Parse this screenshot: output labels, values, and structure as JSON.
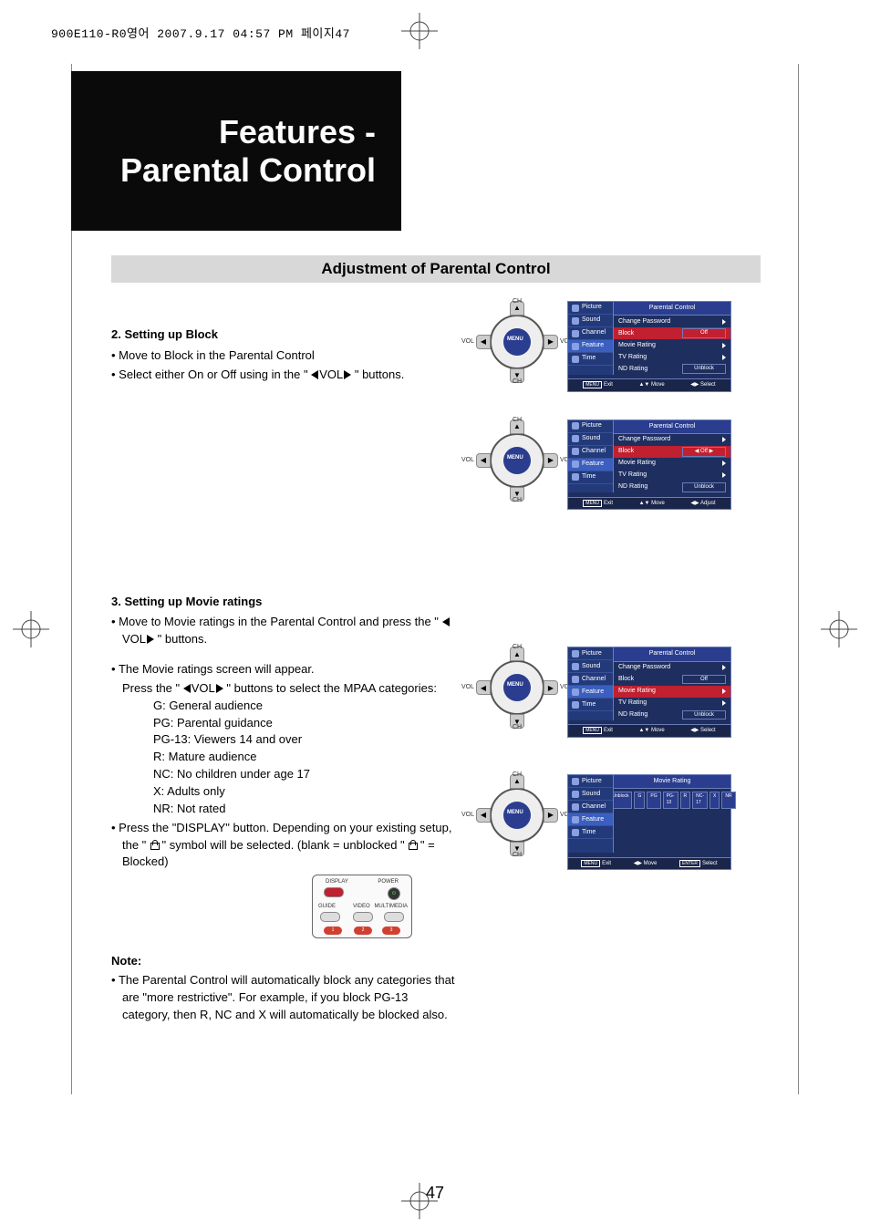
{
  "header_strip": "900E110-R0영어  2007.9.17 04:57 PM 페이지47",
  "title": {
    "line1": "Features -",
    "line2": "Parental Control"
  },
  "subheading": "Adjustment of Parental Control",
  "page_number": "47",
  "sections": {
    "block": {
      "heading": "2. Setting up Block",
      "b1": "Move to Block in the Parental Control",
      "b2_a": "Select either On or Off using in the \" ",
      "b2_b": "VOL",
      "b2_c": " \" buttons."
    },
    "movie": {
      "heading": "3. Setting up Movie ratings",
      "b1_a": "Move to Movie ratings in the Parental Control and press the \" ",
      "b1_b": "VOL",
      "b1_c": " \" buttons.",
      "b2": "The Movie ratings screen will appear.",
      "b2_line_a": "Press the \" ",
      "b2_line_b": "VOL",
      "b2_line_c": " \" buttons to select the MPAA categories:",
      "ratings": {
        "g": "G: General audience",
        "pg": "PG: Parental guidance",
        "pg13": "PG-13: Viewers 14 and over",
        "r": "R: Mature audience",
        "nc": "NC: No children under age 17",
        "x": "X: Adults only",
        "nr": "NR: Not rated"
      },
      "b3_a": "Press the \"DISPLAY\" button. Depending on your existing setup, the \" ",
      "b3_b": " \" symbol will be selected. (blank = unblocked \" ",
      "b3_c": " \" = Blocked)"
    },
    "note": {
      "heading": "Note:",
      "b1": "The Parental Control will automatically block any categories that are \"more restrictive\". For example, if you block PG-13 category, then R, NC and X will automatically be blocked also."
    }
  },
  "dpad": {
    "menu": "MENU",
    "ch": "CH",
    "vol": "VOL"
  },
  "osd": {
    "side": {
      "picture": "Picture",
      "sound": "Sound",
      "channel": "Channel",
      "feature": "Feature",
      "time": "Time"
    },
    "title_pc": "Parental Control",
    "title_mr": "Movie Rating",
    "rows": {
      "change_pw": "Change Password",
      "block": "Block",
      "movie_rating": "Movie Rating",
      "tv_rating": "TV Rating",
      "nd_rating": "ND Rating"
    },
    "values": {
      "off": "Off",
      "unblock": "Unblock"
    },
    "mr_chips": [
      "Unblock",
      "G",
      "PG",
      "PG-13",
      "R",
      "NC-17",
      "X",
      "NR"
    ],
    "footer": {
      "menu": "MENU",
      "exit": "Exit",
      "move": "Move",
      "enter": "ENTER",
      "select": "Select",
      "adjust": "Adjust"
    }
  },
  "remote": {
    "display": "DISPLAY",
    "power": "POWER",
    "guide": "GUIDE",
    "video": "VIDEO",
    "multimedia": "MULTIMEDIA",
    "n1": "1",
    "n2": "2",
    "n3": "3"
  }
}
